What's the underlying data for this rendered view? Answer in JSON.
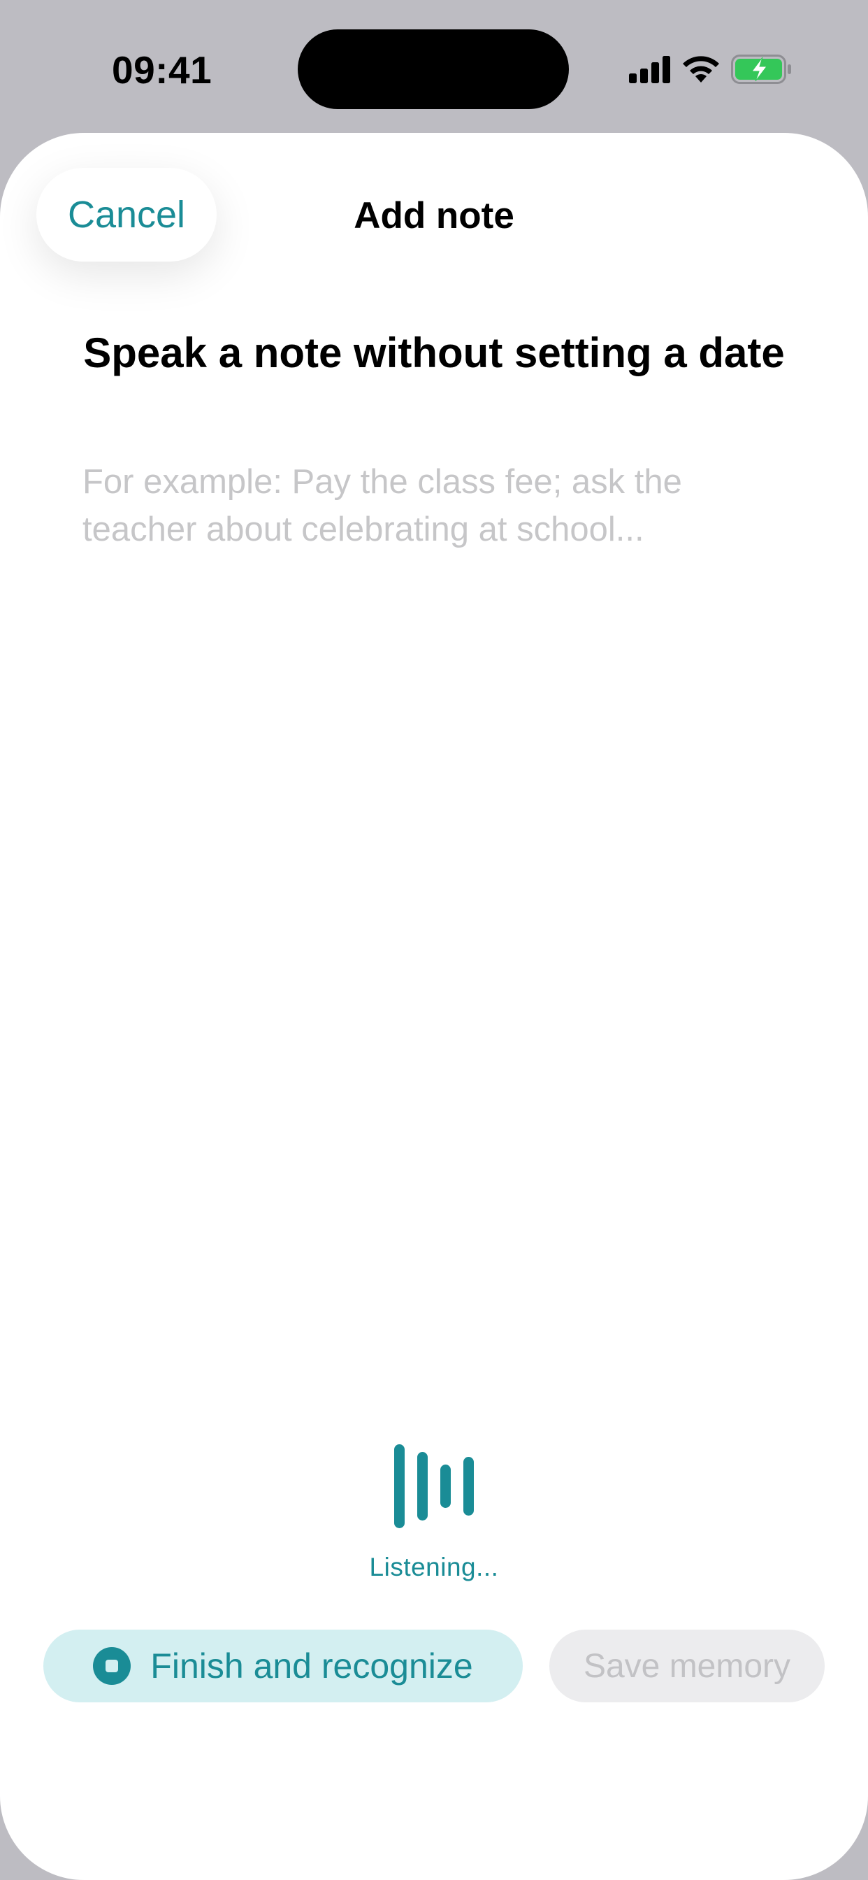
{
  "status_bar": {
    "time": "09:41",
    "icons": [
      "cellular-signal-icon",
      "wifi-icon",
      "battery-charging-icon"
    ]
  },
  "header": {
    "cancel_label": "Cancel",
    "title": "Add note"
  },
  "main": {
    "heading": "Speak a note without setting a date",
    "note_input": {
      "value": "",
      "placeholder": "For example: Pay the class fee; ask the teacher about celebrating at school..."
    }
  },
  "voice": {
    "status_text": "Listening...",
    "icon": "sound-wave-icon"
  },
  "actions": {
    "finish_label": "Finish and recognize",
    "finish_icon": "stop-icon",
    "save_label": "Save memory",
    "save_enabled": false
  },
  "colors": {
    "accent": "#1a8c96",
    "accent_light": "#d3eff1",
    "disabled_bg": "#ececee",
    "disabled_text": "#c2c2c5",
    "placeholder": "#c6c6c8",
    "backdrop": "#bdbcc2",
    "battery_green": "#34c759"
  }
}
